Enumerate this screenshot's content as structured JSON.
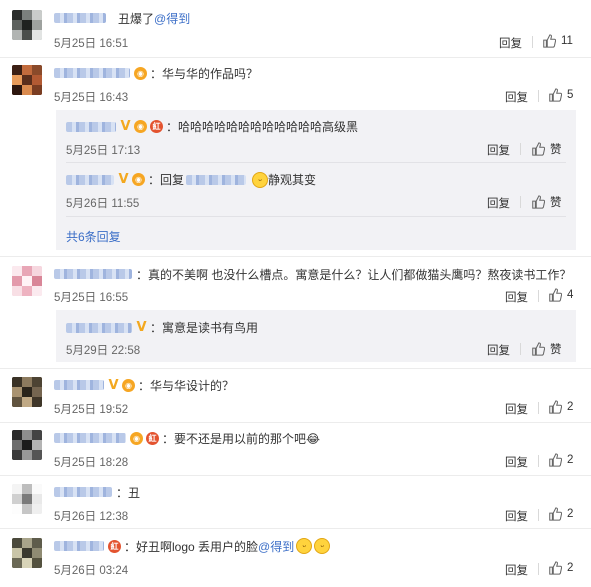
{
  "reply_label": "回复",
  "like_label": "赞",
  "comments": [
    {
      "text": "丑爆了",
      "mention": "@得到",
      "time": "5月25日 16:51",
      "likes": "11"
    },
    {
      "text": "：华与华的作品吗？",
      "time": "5月25日 16:43",
      "likes": "5",
      "subs": [
        {
          "text": "：哈哈哈哈哈哈哈哈哈哈哈哈高级黑",
          "time": "5月25日 17:13"
        },
        {
          "prefix": "：回复",
          "text": "静观其变",
          "time": "5月26日 11:55"
        }
      ],
      "more": "共6条回复"
    },
    {
      "text": "：真的不美啊 也没什么槽点。寓意是什么？让人们都做猫头鹰吗？熬夜读书工作？",
      "time": "5月25日 16:55",
      "likes": "4",
      "subs": [
        {
          "text": "：寓意是读书有鸟用",
          "time": "5月29日 22:58"
        }
      ]
    },
    {
      "text": "：华与华设计的？",
      "time": "5月25日 19:52",
      "likes": "2"
    },
    {
      "text": "：要不还是用以前的那个吧😂",
      "time": "5月25日 18:28",
      "likes": "2"
    },
    {
      "text": "：丑",
      "time": "5月26日 12:38",
      "likes": "2"
    },
    {
      "text": "：好丑啊logo 丢用户的脸",
      "mention": "@得到",
      "time": "5月26日 03:24",
      "likes": "2"
    }
  ],
  "icons": {
    "thumb": "thumbs-up-icon",
    "verified": "verified-v-icon"
  },
  "colors": {
    "link": "#3b6ec7",
    "badge_red": "#e3532f",
    "verified": "#f3a81f"
  }
}
